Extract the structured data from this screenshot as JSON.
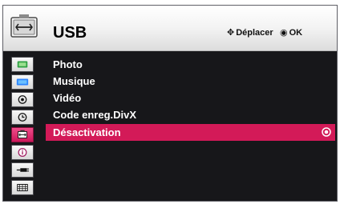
{
  "header": {
    "title": "USB",
    "move_hint": "Déplacer",
    "ok_hint": "OK",
    "move_icon": "four-way-arrow-icon",
    "ok_icon": "ok-circle-icon"
  },
  "sidebar": {
    "items": [
      {
        "name": "picture-icon",
        "active": false
      },
      {
        "name": "display-icon",
        "active": false
      },
      {
        "name": "audio-icon",
        "active": false
      },
      {
        "name": "clock-icon",
        "active": false
      },
      {
        "name": "usb-icon",
        "active": true
      },
      {
        "name": "info-icon",
        "active": false
      },
      {
        "name": "input-icon",
        "active": false
      },
      {
        "name": "film-icon",
        "active": false
      }
    ]
  },
  "menu": {
    "items": [
      {
        "label": "Photo",
        "selected": false
      },
      {
        "label": "Musique",
        "selected": false
      },
      {
        "label": "Vidéo",
        "selected": false
      },
      {
        "label": "Code enreg.DivX",
        "selected": false
      },
      {
        "label": "Désactivation",
        "selected": true
      }
    ]
  },
  "colors": {
    "selection": "#d31a58",
    "background": "#17171a",
    "header_top": "#ffffff",
    "header_bottom": "#dcdcdc"
  }
}
